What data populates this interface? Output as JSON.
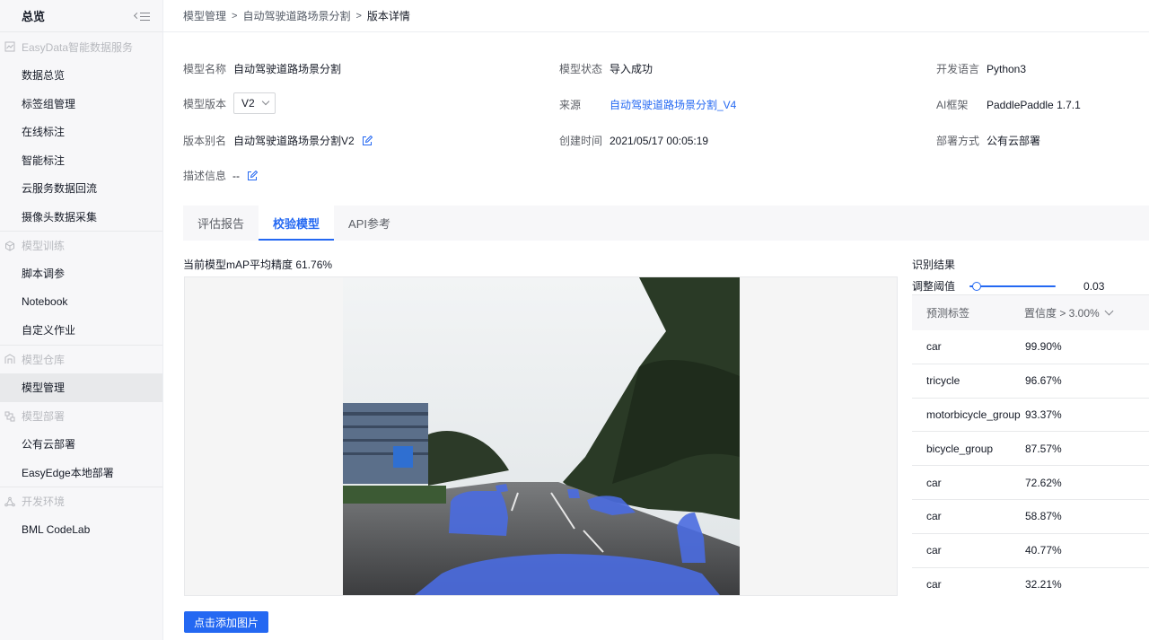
{
  "sidebar": {
    "title": "总览",
    "groups": [
      {
        "label": "EasyData智能数据服务",
        "icon": "chart-line-icon",
        "items": [
          "数据总览",
          "标签组管理",
          "在线标注",
          "智能标注",
          "云服务数据回流",
          "摄像头数据采集"
        ]
      },
      {
        "label": "模型训练",
        "icon": "cube-icon",
        "items": [
          "脚本调参",
          "Notebook",
          "自定义作业"
        ]
      },
      {
        "label": "模型仓库",
        "icon": "warehouse-icon",
        "items": [
          "模型管理"
        ]
      },
      {
        "label": "模型部署",
        "icon": "deploy-icon",
        "items": [
          "公有云部署",
          "EasyEdge本地部署"
        ]
      },
      {
        "label": "开发环境",
        "icon": "network-icon",
        "items": [
          "BML CodeLab"
        ]
      }
    ],
    "active_item": "模型管理"
  },
  "breadcrumb": [
    "模型管理",
    "自动驾驶道路场景分割",
    "版本详情"
  ],
  "info": {
    "model_name_label": "模型名称",
    "model_name": "自动驾驶道路场景分割",
    "model_status_label": "模型状态",
    "model_status": "导入成功",
    "dev_lang_label": "开发语言",
    "dev_lang": "Python3",
    "model_version_label": "模型版本",
    "model_version": "V2",
    "source_label": "来源",
    "source": "自动驾驶道路场景分割_V4",
    "ai_framework_label": "AI框架",
    "ai_framework": "PaddlePaddle 1.7.1",
    "alias_label": "版本别名",
    "alias": "自动驾驶道路场景分割V2",
    "created_label": "创建时间",
    "created": "2021/05/17 00:05:19",
    "deploy_label": "部署方式",
    "deploy": "公有云部署",
    "desc_label": "描述信息",
    "desc": "--"
  },
  "tabs": [
    "评估报告",
    "校验模型",
    "API参考"
  ],
  "active_tab": "校验模型",
  "map_text": "当前模型mAP平均精度 61.76%",
  "add_image_label": "点击添加图片",
  "results": {
    "title": "识别结果",
    "threshold_label": "调整阈值",
    "threshold_value": "0.03",
    "threshold_fraction": 0.03,
    "col_label": "预测标签",
    "col_conf": "置信度 > 3.00%",
    "rows": [
      {
        "label": "car",
        "conf": "99.90%"
      },
      {
        "label": "tricycle",
        "conf": "96.67%"
      },
      {
        "label": "motorbicycle_group",
        "conf": "93.37%"
      },
      {
        "label": "bicycle_group",
        "conf": "87.57%"
      },
      {
        "label": "car",
        "conf": "72.62%"
      },
      {
        "label": "car",
        "conf": "58.87%"
      },
      {
        "label": "car",
        "conf": "40.77%"
      },
      {
        "label": "car",
        "conf": "32.21%"
      }
    ]
  },
  "colors": {
    "accent": "#2468f2",
    "mask": "#4a6be0"
  }
}
